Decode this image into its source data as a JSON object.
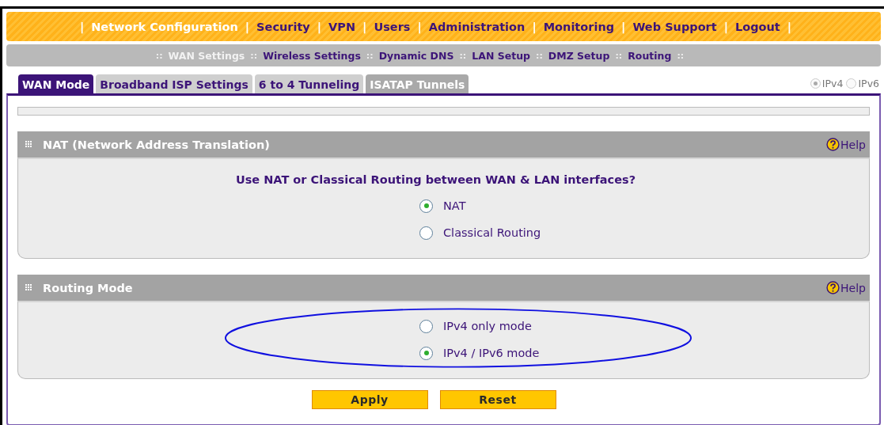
{
  "menu_separator": "|",
  "sub_menu_separator": "::",
  "main_menu": [
    {
      "label": "Network Configuration",
      "selected": true
    },
    {
      "label": "Security",
      "selected": false
    },
    {
      "label": "VPN",
      "selected": false
    },
    {
      "label": "Users",
      "selected": false
    },
    {
      "label": "Administration",
      "selected": false
    },
    {
      "label": "Monitoring",
      "selected": false
    },
    {
      "label": "Web Support",
      "selected": false
    },
    {
      "label": "Logout",
      "selected": false
    }
  ],
  "sub_menu": [
    {
      "label": "WAN Settings",
      "selected": true
    },
    {
      "label": "Wireless Settings",
      "selected": false
    },
    {
      "label": "Dynamic DNS",
      "selected": false
    },
    {
      "label": "LAN Setup",
      "selected": false
    },
    {
      "label": "DMZ Setup",
      "selected": false
    },
    {
      "label": "Routing",
      "selected": false
    }
  ],
  "tabs": [
    {
      "label": "WAN Mode",
      "selected": true,
      "disabled": false
    },
    {
      "label": "Broadband ISP Settings",
      "selected": false,
      "disabled": false
    },
    {
      "label": "6 to 4 Tunneling",
      "selected": false,
      "disabled": false
    },
    {
      "label": "ISATAP Tunnels",
      "selected": false,
      "disabled": true
    }
  ],
  "ip_version": [
    {
      "label": "IPv4",
      "selected": true
    },
    {
      "label": "IPv6",
      "selected": false
    }
  ],
  "sections": [
    {
      "title": "NAT (Network Address Translation)",
      "help": "Help",
      "question": "Use NAT or Classical Routing between WAN & LAN interfaces?",
      "highlighted": false,
      "options": [
        {
          "label": "NAT",
          "selected": true
        },
        {
          "label": "Classical Routing",
          "selected": false
        }
      ]
    },
    {
      "title": "Routing Mode",
      "help": "Help",
      "highlighted": true,
      "options": [
        {
          "label": "IPv4 only mode",
          "selected": false
        },
        {
          "label": "IPv4 / IPv6 mode",
          "selected": true
        }
      ]
    }
  ],
  "buttons": [
    "Apply",
    "Reset"
  ]
}
